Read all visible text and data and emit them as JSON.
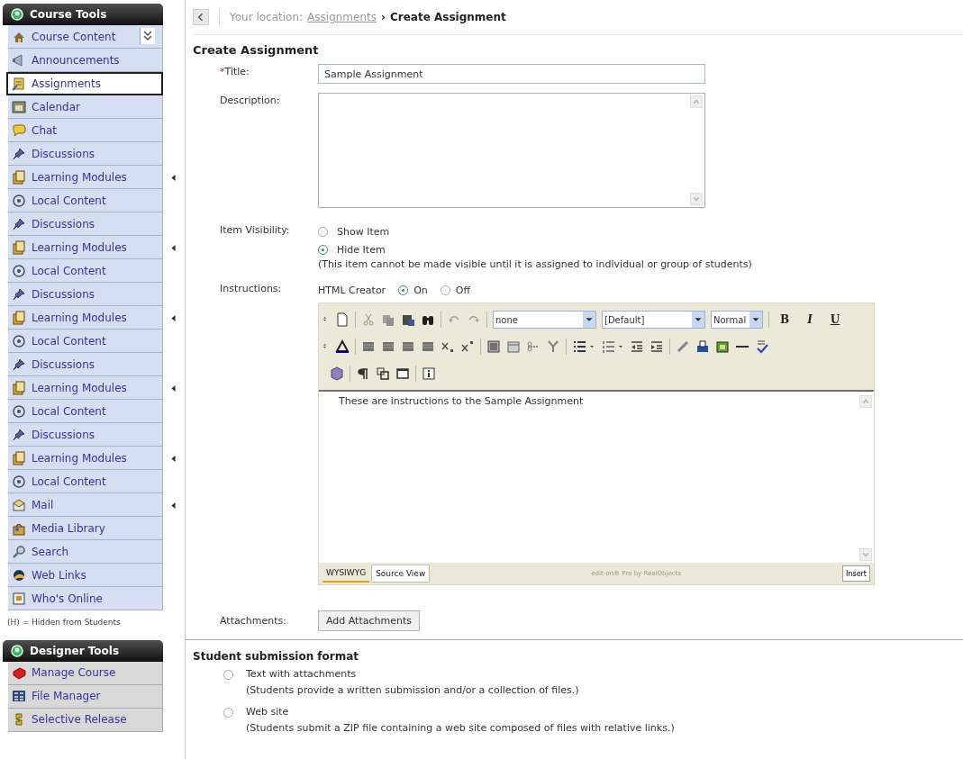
{
  "course_tools": {
    "title": "Course Tools",
    "items": [
      {
        "label": "Course Content",
        "selected": false,
        "expander": false,
        "menu_toggle": true
      },
      {
        "label": "Announcements",
        "selected": false,
        "expander": false,
        "menu_toggle": false
      },
      {
        "label": "Assignments",
        "selected": true,
        "expander": false,
        "menu_toggle": false
      },
      {
        "label": "Calendar",
        "selected": false,
        "expander": false,
        "menu_toggle": false
      },
      {
        "label": "Chat",
        "selected": false,
        "expander": false,
        "menu_toggle": false
      },
      {
        "label": "Discussions",
        "selected": false,
        "expander": false,
        "menu_toggle": false
      },
      {
        "label": "Learning Modules",
        "selected": false,
        "expander": true,
        "menu_toggle": false
      },
      {
        "label": "Local Content",
        "selected": false,
        "expander": false,
        "menu_toggle": false
      },
      {
        "label": "Discussions",
        "selected": false,
        "expander": false,
        "menu_toggle": false
      },
      {
        "label": "Learning Modules",
        "selected": false,
        "expander": true,
        "menu_toggle": false
      },
      {
        "label": "Local Content",
        "selected": false,
        "expander": false,
        "menu_toggle": false
      },
      {
        "label": "Discussions",
        "selected": false,
        "expander": false,
        "menu_toggle": false
      },
      {
        "label": "Learning Modules",
        "selected": false,
        "expander": true,
        "menu_toggle": false
      },
      {
        "label": "Local Content",
        "selected": false,
        "expander": false,
        "menu_toggle": false
      },
      {
        "label": "Discussions",
        "selected": false,
        "expander": false,
        "menu_toggle": false
      },
      {
        "label": "Learning Modules",
        "selected": false,
        "expander": true,
        "menu_toggle": false
      },
      {
        "label": "Local Content",
        "selected": false,
        "expander": false,
        "menu_toggle": false
      },
      {
        "label": "Discussions",
        "selected": false,
        "expander": false,
        "menu_toggle": false
      },
      {
        "label": "Learning Modules",
        "selected": false,
        "expander": true,
        "menu_toggle": false
      },
      {
        "label": "Local Content",
        "selected": false,
        "expander": false,
        "menu_toggle": false
      },
      {
        "label": "Mail",
        "selected": false,
        "expander": true,
        "menu_toggle": false
      },
      {
        "label": "Media Library",
        "selected": false,
        "expander": false,
        "menu_toggle": false
      },
      {
        "label": "Search",
        "selected": false,
        "expander": false,
        "menu_toggle": false
      },
      {
        "label": "Web Links",
        "selected": false,
        "expander": false,
        "menu_toggle": false
      },
      {
        "label": "Who's Online",
        "selected": false,
        "expander": false,
        "menu_toggle": false
      }
    ],
    "legend": "(H) = Hidden from Students"
  },
  "designer_tools": {
    "title": "Designer Tools",
    "items": [
      {
        "label": "Manage Course"
      },
      {
        "label": "File Manager"
      },
      {
        "label": "Selective Release"
      }
    ]
  },
  "breadcrumb": {
    "prefix": "Your location:",
    "link": "Assignments",
    "separator": "›",
    "current": "Create Assignment"
  },
  "heading": "Create Assignment",
  "title_field": {
    "required_mark": "*",
    "label": "Title:",
    "value": "Sample Assignment"
  },
  "description_field": {
    "label": "Description:"
  },
  "visibility": {
    "label": "Item Visibility:",
    "options": [
      {
        "label": "Show Item",
        "selected": false
      },
      {
        "label": "Hide Item",
        "selected": true
      }
    ],
    "note": "(This item cannot be made visible until it is assigned to individual or group of students)"
  },
  "instructions": {
    "label": "Instructions:",
    "creator_label": "HTML Creator",
    "options": [
      {
        "label": "On",
        "selected": true
      },
      {
        "label": "Off",
        "selected": false
      }
    ],
    "editor": {
      "selects": [
        {
          "value": "none"
        },
        {
          "value": "[Default]"
        },
        {
          "value": "Normal"
        }
      ],
      "format_buttons": [
        "B",
        "I",
        "U"
      ],
      "content": "These are instructions to the Sample Assignment",
      "tabs": [
        {
          "label": "WYSIWYG",
          "selected": true
        },
        {
          "label": "Source View",
          "selected": false
        }
      ],
      "credit": "edit-on® Pro by RealObjects",
      "insert_button": "Insert"
    }
  },
  "attachments": {
    "label": "Attachments:",
    "button": "Add Attachments"
  },
  "submission": {
    "heading": "Student submission format",
    "options": [
      {
        "label": "Text with attachments",
        "note": "(Students provide a written submission and/or a collection of files.)",
        "selected": false
      },
      {
        "label": "Web site",
        "note": "(Students submit a ZIP file containing a web site composed of files with relative links.)",
        "selected": false
      }
    ]
  }
}
